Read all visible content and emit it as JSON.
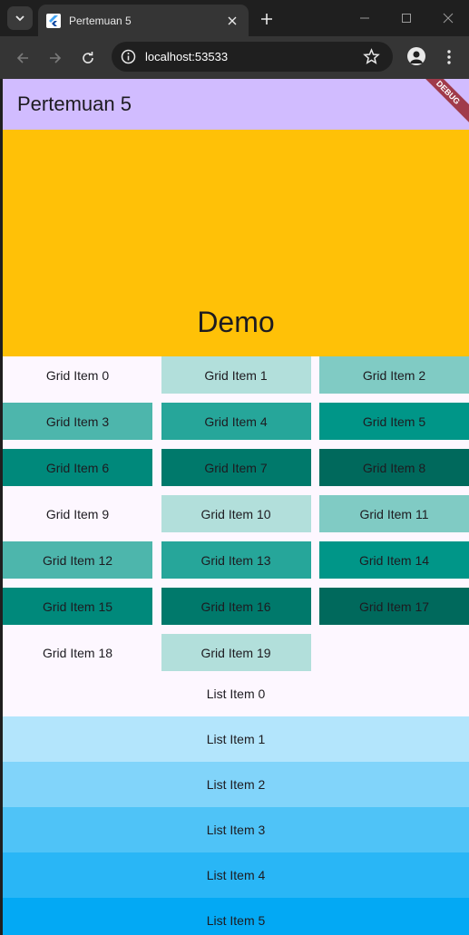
{
  "browser": {
    "tab_title": "Pertemuan 5",
    "url": "localhost:53533"
  },
  "app": {
    "title": "Pertemuan 5",
    "debug_banner": "DEBUG",
    "appbar_color": "#d1bcff",
    "header_color": "#ffc107",
    "header_title": "Demo"
  },
  "grid": {
    "items": [
      {
        "label": "Grid Item 0",
        "color": "#fdf7ff"
      },
      {
        "label": "Grid Item 1",
        "color": "#b2dfdb"
      },
      {
        "label": "Grid Item 2",
        "color": "#80cbc4"
      },
      {
        "label": "Grid Item 3",
        "color": "#4db6ac"
      },
      {
        "label": "Grid Item 4",
        "color": "#26a69a"
      },
      {
        "label": "Grid Item 5",
        "color": "#009688"
      },
      {
        "label": "Grid Item 6",
        "color": "#00897b"
      },
      {
        "label": "Grid Item 7",
        "color": "#00796b"
      },
      {
        "label": "Grid Item 8",
        "color": "#00695c"
      },
      {
        "label": "Grid Item 9",
        "color": "#fdf7ff"
      },
      {
        "label": "Grid Item 10",
        "color": "#b2dfdb"
      },
      {
        "label": "Grid Item 11",
        "color": "#80cbc4"
      },
      {
        "label": "Grid Item 12",
        "color": "#4db6ac"
      },
      {
        "label": "Grid Item 13",
        "color": "#26a69a"
      },
      {
        "label": "Grid Item 14",
        "color": "#009688"
      },
      {
        "label": "Grid Item 15",
        "color": "#00897b"
      },
      {
        "label": "Grid Item 16",
        "color": "#00796b"
      },
      {
        "label": "Grid Item 17",
        "color": "#00695c"
      },
      {
        "label": "Grid Item 18",
        "color": "#fdf7ff"
      },
      {
        "label": "Grid Item 19",
        "color": "#b2dfdb"
      }
    ]
  },
  "list": {
    "items": [
      {
        "label": "List Item 0",
        "color": "#fdf7ff"
      },
      {
        "label": "List Item 1",
        "color": "#b3e5fc"
      },
      {
        "label": "List Item 2",
        "color": "#81d4fa"
      },
      {
        "label": "List Item 3",
        "color": "#4fc3f7"
      },
      {
        "label": "List Item 4",
        "color": "#29b6f6"
      },
      {
        "label": "List Item 5",
        "color": "#03a9f4"
      }
    ]
  }
}
